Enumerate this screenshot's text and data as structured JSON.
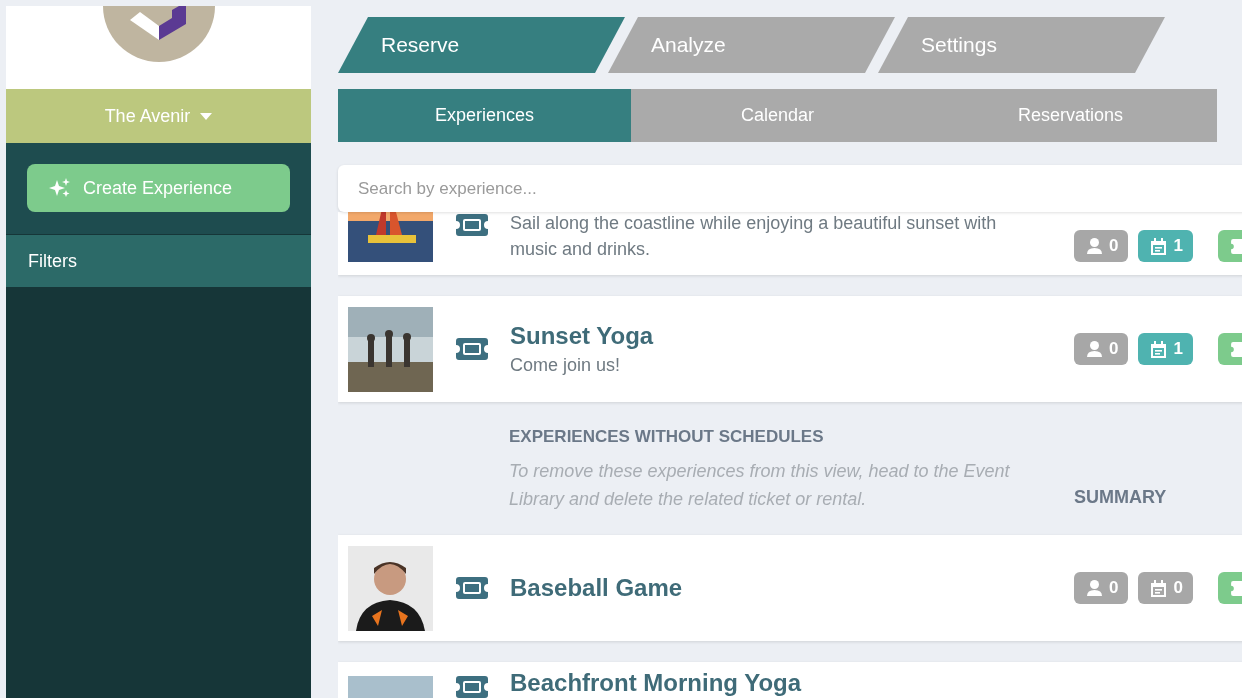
{
  "sidebar": {
    "venue": "The Avenir",
    "create_button": "Create Experience",
    "filters": "Filters"
  },
  "top_tabs": [
    {
      "label": "Reserve",
      "selected": true
    },
    {
      "label": "Analyze",
      "selected": false
    },
    {
      "label": "Settings",
      "selected": false
    }
  ],
  "sub_tabs": [
    {
      "label": "Experiences",
      "selected": true
    },
    {
      "label": "Calendar",
      "selected": false
    },
    {
      "label": "Reservations",
      "selected": false
    }
  ],
  "search": {
    "placeholder": "Search by experience..."
  },
  "experiences": [
    {
      "kind": "card",
      "description": "Sail along the coastline while enjoying a beautiful sunset with music and drinks.",
      "guests": "0",
      "schedules": "1",
      "has_schedules": true
    },
    {
      "kind": "card",
      "title": "Sunset Yoga",
      "description": "Come join us!",
      "guests": "0",
      "schedules": "1",
      "has_schedules": true
    },
    {
      "kind": "section",
      "heading": "EXPERIENCES WITHOUT SCHEDULES",
      "note": "To remove these experiences from this view, head to the Event Library and delete the related ticket or rental.",
      "summary": "SUMMARY"
    },
    {
      "kind": "card",
      "title": "Baseball Game",
      "guests": "0",
      "schedules": "0",
      "has_schedules": false
    },
    {
      "kind": "card",
      "title": "Beachfront Morning Yoga"
    }
  ]
}
